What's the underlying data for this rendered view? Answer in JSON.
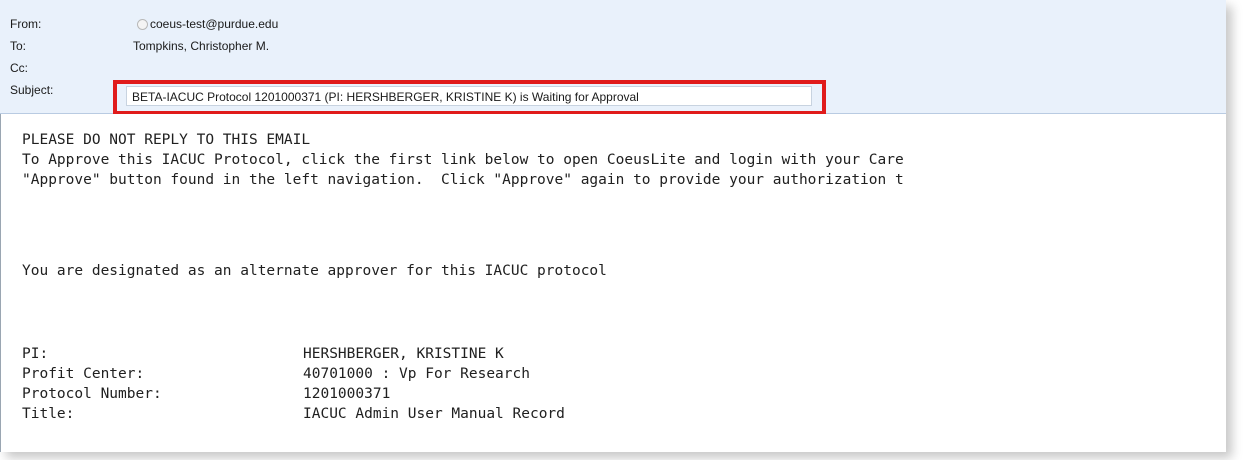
{
  "email": {
    "header": {
      "from_label": "From:",
      "from_value": "coeus-test@purdue.edu",
      "to_label": "To:",
      "to_value": "Tompkins, Christopher M.",
      "cc_label": "Cc:",
      "cc_value": "",
      "subject_label": "Subject:",
      "subject_value": "BETA-IACUC Protocol 1201000371 (PI: HERSHBERGER, KRISTINE K) is Waiting for Approval"
    },
    "body": {
      "line1": "PLEASE DO NOT REPLY TO THIS EMAIL",
      "line2": "To Approve this IACUC Protocol, click the first link below to open CoeusLite and login with your Care",
      "line3": "\"Approve\" button found in the left navigation.  Click \"Approve\" again to provide your authorization t",
      "line4": "You are designated as an alternate approver for this IACUC protocol",
      "fields": [
        {
          "label": "PI:",
          "value": "HERSHBERGER, KRISTINE K"
        },
        {
          "label": "Profit Center:",
          "value": "40701000 : Vp For Research"
        },
        {
          "label": "Protocol Number:",
          "value": "1201000371"
        },
        {
          "label": "Title:",
          "value": "IACUC Admin User Manual Record"
        }
      ]
    }
  },
  "colors": {
    "header_bg": "#e9f1fb",
    "highlight": "#e01b1b"
  },
  "icons": {
    "presence": "presence-status-icon"
  }
}
